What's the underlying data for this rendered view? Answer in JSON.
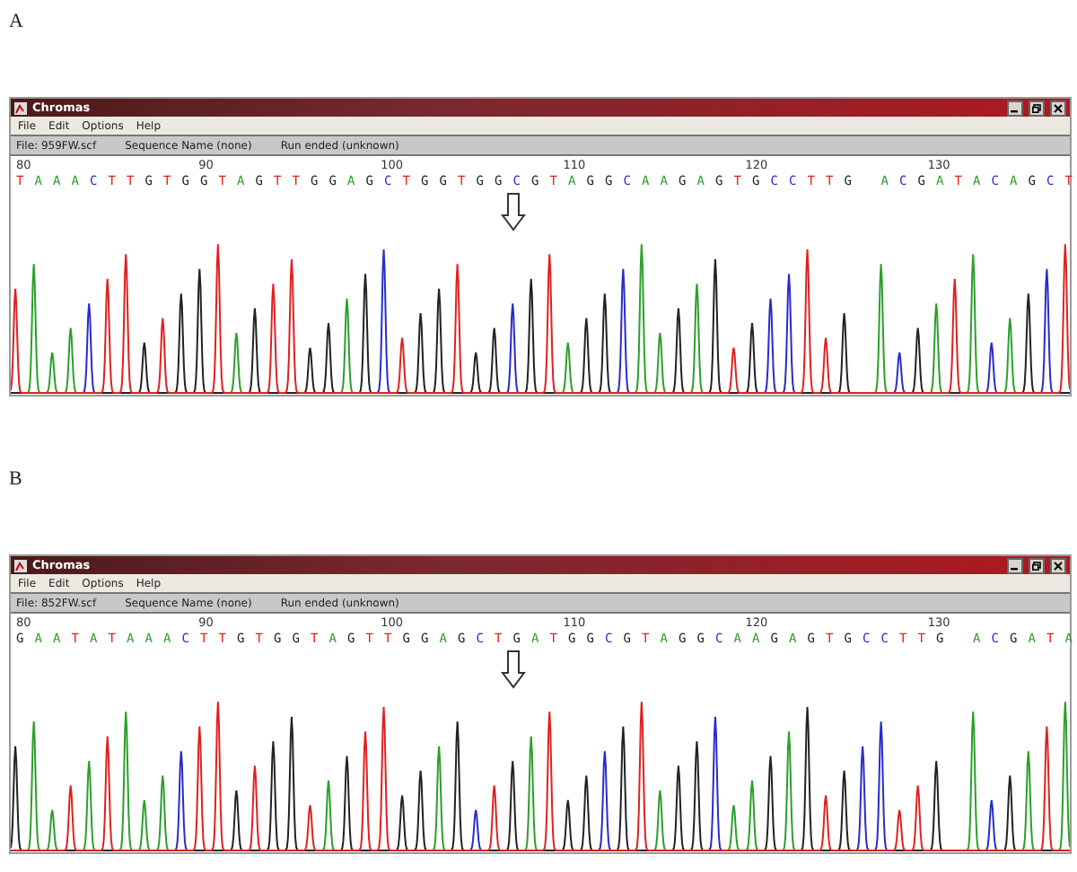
{
  "panels": [
    {
      "label": "A",
      "window": {
        "title": "Chromas",
        "menu": [
          "File",
          "Edit",
          "Options",
          "Help"
        ],
        "info": [
          "File: 959FW.scf",
          "Sequence Name (none)",
          "Run ended (unknown)"
        ],
        "ticks": [
          "80",
          "90",
          "100",
          "110",
          "120",
          "130"
        ],
        "sequence": "T A A A C T T G T G G T A G T T G G A G C T G G T G G C G T A G G C A A G A G T G C C T T G   A C G A T A C A G C T"
      }
    },
    {
      "label": "B",
      "window": {
        "title": "Chromas",
        "menu": [
          "File",
          "Edit",
          "Options",
          "Help"
        ],
        "info": [
          "File: 852FW.scf",
          "Sequence Name (none)",
          "Run ended (unknown)"
        ],
        "ticks": [
          "80",
          "90",
          "100",
          "110",
          "120",
          "130"
        ],
        "sequence": "G A A T A T A A A C T T G T G G T A G T T G G A G C T G A T G G C G T A G G C A A G A G T G C C T T G   A C G A T A"
      }
    }
  ]
}
